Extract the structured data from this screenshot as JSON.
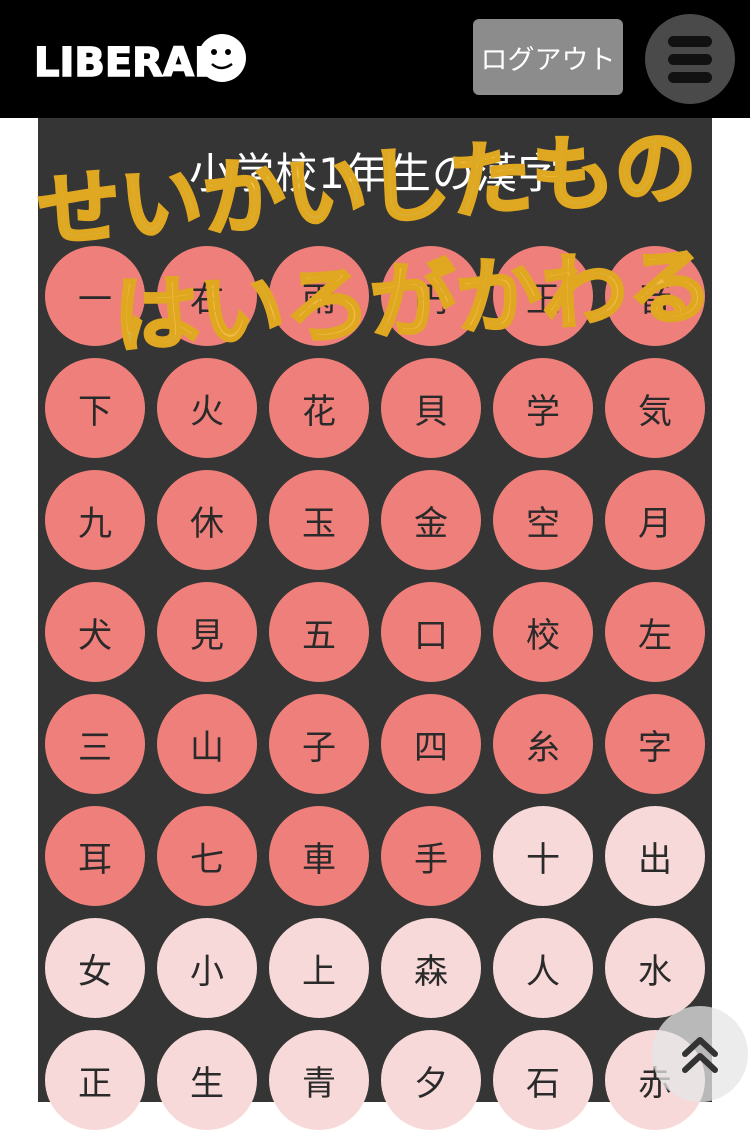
{
  "header": {
    "logo_text": "LIBERAL",
    "logout_label": "ログアウト"
  },
  "page": {
    "title": "小学校1年生の漢字"
  },
  "overlay_text": {
    "line1": "せいかいしたもの",
    "line2": "はいろがかわる"
  },
  "kanji_rows": [
    [
      {
        "c": "一",
        "s": "learned"
      },
      {
        "c": "右",
        "s": "learned"
      },
      {
        "c": "雨",
        "s": "learned"
      },
      {
        "c": "円",
        "s": "learned"
      },
      {
        "c": "王",
        "s": "learned"
      },
      {
        "c": "音",
        "s": "learned"
      }
    ],
    [
      {
        "c": "下",
        "s": "learned"
      },
      {
        "c": "火",
        "s": "learned"
      },
      {
        "c": "花",
        "s": "learned"
      },
      {
        "c": "貝",
        "s": "learned"
      },
      {
        "c": "学",
        "s": "learned"
      },
      {
        "c": "気",
        "s": "learned"
      }
    ],
    [
      {
        "c": "九",
        "s": "learned"
      },
      {
        "c": "休",
        "s": "learned"
      },
      {
        "c": "玉",
        "s": "learned"
      },
      {
        "c": "金",
        "s": "learned"
      },
      {
        "c": "空",
        "s": "learned"
      },
      {
        "c": "月",
        "s": "learned"
      }
    ],
    [
      {
        "c": "犬",
        "s": "learned"
      },
      {
        "c": "見",
        "s": "learned"
      },
      {
        "c": "五",
        "s": "learned"
      },
      {
        "c": "口",
        "s": "learned"
      },
      {
        "c": "校",
        "s": "learned"
      },
      {
        "c": "左",
        "s": "learned"
      }
    ],
    [
      {
        "c": "三",
        "s": "learned"
      },
      {
        "c": "山",
        "s": "learned"
      },
      {
        "c": "子",
        "s": "learned"
      },
      {
        "c": "四",
        "s": "learned"
      },
      {
        "c": "糸",
        "s": "learned"
      },
      {
        "c": "字",
        "s": "learned"
      }
    ],
    [
      {
        "c": "耳",
        "s": "learned"
      },
      {
        "c": "七",
        "s": "learned"
      },
      {
        "c": "車",
        "s": "learned"
      },
      {
        "c": "手",
        "s": "learned"
      },
      {
        "c": "十",
        "s": "unlearned"
      },
      {
        "c": "出",
        "s": "unlearned"
      }
    ],
    [
      {
        "c": "女",
        "s": "unlearned"
      },
      {
        "c": "小",
        "s": "unlearned"
      },
      {
        "c": "上",
        "s": "unlearned"
      },
      {
        "c": "森",
        "s": "unlearned"
      },
      {
        "c": "人",
        "s": "unlearned"
      },
      {
        "c": "水",
        "s": "unlearned"
      }
    ],
    [
      {
        "c": "正",
        "s": "unlearned"
      },
      {
        "c": "生",
        "s": "unlearned"
      },
      {
        "c": "青",
        "s": "unlearned"
      },
      {
        "c": "夕",
        "s": "unlearned"
      },
      {
        "c": "石",
        "s": "unlearned"
      },
      {
        "c": "赤",
        "s": "unlearned"
      }
    ]
  ],
  "colors": {
    "learned": "#ee7f7b",
    "unlearned": "#f8d9d9",
    "panel": "#353535",
    "overlay": "#f2c63a"
  },
  "icons": {
    "menu": "hamburger-icon",
    "scroll_top": "double-chevron-up-icon"
  }
}
